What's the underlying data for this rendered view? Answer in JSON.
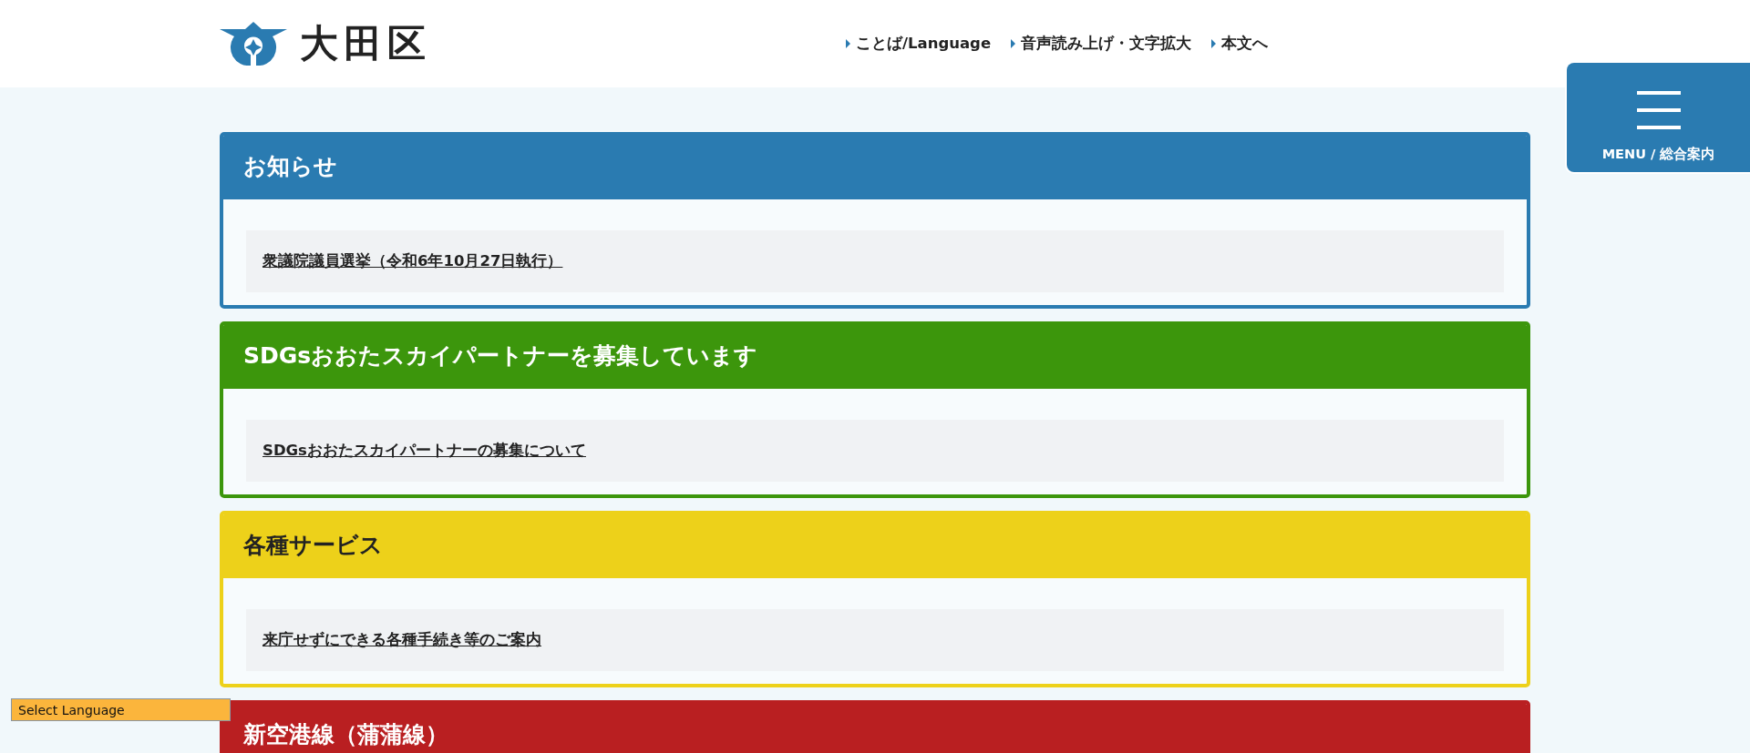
{
  "header": {
    "logo_text": "大田区",
    "links": [
      {
        "label": "ことば/Language"
      },
      {
        "label": "音声読み上げ・文字拡大"
      },
      {
        "label": "本文へ"
      }
    ]
  },
  "menu_button": {
    "label": "MENU / 総合案内"
  },
  "panels": [
    {
      "title": "お知らせ",
      "color": "#2a7bb1",
      "links": [
        "衆議院議員選挙（令和6年10月27日執行）"
      ]
    },
    {
      "title": "SDGsおおたスカイパートナーを募集しています",
      "color": "#3c960c",
      "links": [
        "SDGsおおたスカイパートナーの募集について"
      ]
    },
    {
      "title": "各種サービス",
      "color": "#edd11a",
      "links": [
        "来庁せずにできる各種手続き等のご案内"
      ]
    },
    {
      "title": "新空港線（蒲蒲線）",
      "color": "#b91f21"
    }
  ],
  "language_select": {
    "label": "Select Language"
  }
}
